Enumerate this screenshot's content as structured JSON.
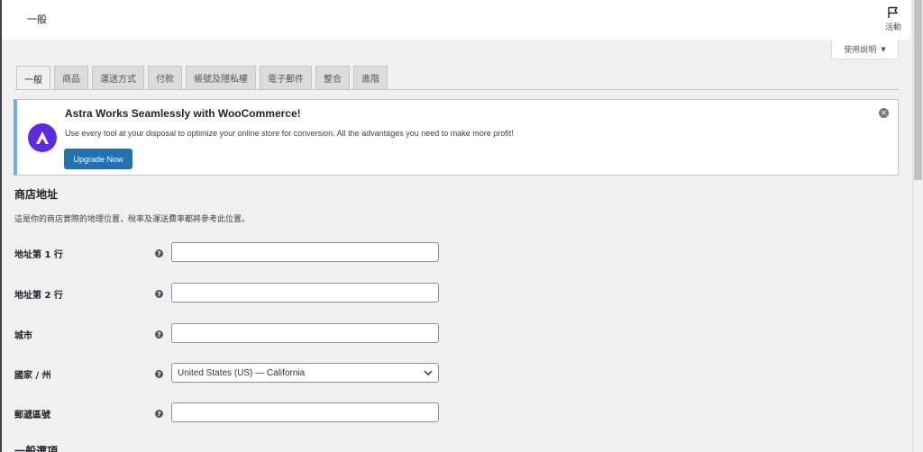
{
  "header": {
    "title": "一般",
    "activity_label": "活動",
    "help_label": "使用說明"
  },
  "tabs": [
    {
      "label": "一般",
      "active": true
    },
    {
      "label": "商品",
      "active": false
    },
    {
      "label": "運送方式",
      "active": false
    },
    {
      "label": "付款",
      "active": false
    },
    {
      "label": "帳號及隱私權",
      "active": false
    },
    {
      "label": "電子郵件",
      "active": false
    },
    {
      "label": "整合",
      "active": false
    },
    {
      "label": "進階",
      "active": false
    }
  ],
  "notice": {
    "title": "Astra Works Seamlessly with WooCommerce!",
    "text": "Use every tool at your disposal to optimize your online store for conversion. All the advantages you need to make more profit!",
    "button_label": "Upgrade Now",
    "logo_icon": "astra-logo-icon",
    "colors": {
      "accent": "#72aee6",
      "logo_bg": "#5d2be0",
      "button": "#2271b1"
    }
  },
  "section": {
    "title": "商店地址",
    "description": "這是你的商店實際的地理位置，稅率及運送費率都將參考此位置。"
  },
  "fields": {
    "address1": {
      "label": "地址第 1 行",
      "value": ""
    },
    "address2": {
      "label": "地址第 2 行",
      "value": ""
    },
    "city": {
      "label": "城市",
      "value": ""
    },
    "country": {
      "label": "國家 / 州",
      "value": "United States (US) — California"
    },
    "postcode": {
      "label": "郵遞區號",
      "value": ""
    }
  },
  "next_section": {
    "title": "一般選項"
  }
}
